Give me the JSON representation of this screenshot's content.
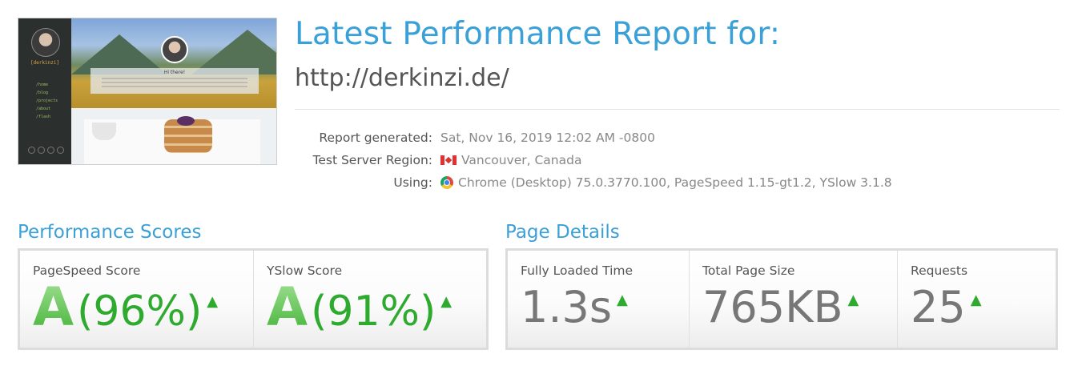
{
  "header": {
    "title": "Latest Performance Report for:",
    "url": "http://derkinzi.de/"
  },
  "thumbnail": {
    "brand": "[derkinzi]",
    "nav": [
      "/home",
      "/blog",
      "/projects",
      "/about",
      "/flash"
    ],
    "greeting": "Hi there!"
  },
  "meta": [
    {
      "label": "Report generated:",
      "value": "Sat, Nov 16, 2019 12:02 AM -0800",
      "icon": "none"
    },
    {
      "label": "Test Server Region:",
      "value": "Vancouver, Canada",
      "icon": "canada-flag"
    },
    {
      "label": "Using:",
      "value": "Chrome (Desktop) 75.0.3770.100, PageSpeed 1.15-gt1.2, YSlow 3.1.8",
      "icon": "chrome"
    }
  ],
  "performance": {
    "title": "Performance Scores",
    "scores": [
      {
        "label": "PageSpeed Score",
        "grade": "A",
        "percent": "(96%)"
      },
      {
        "label": "YSlow Score",
        "grade": "A",
        "percent": "(91%)"
      }
    ]
  },
  "details": {
    "title": "Page Details",
    "items": [
      {
        "label": "Fully Loaded Time",
        "value": "1.3s"
      },
      {
        "label": "Total Page Size",
        "value": "765KB"
      },
      {
        "label": "Requests",
        "value": "25"
      }
    ]
  },
  "colors": {
    "accent": "#3aa0d8",
    "grade_green": "#2eaa2e",
    "value_gray": "#777777"
  }
}
